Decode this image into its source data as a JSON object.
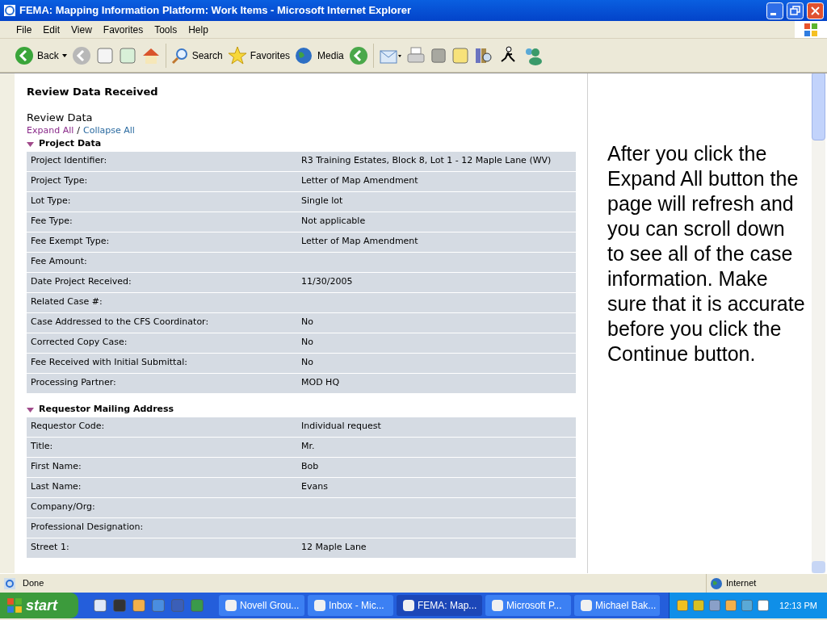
{
  "window": {
    "title": "FEMA: Mapping Information Platform: Work Items - Microsoft Internet Explorer"
  },
  "menu": [
    "File",
    "Edit",
    "View",
    "Favorites",
    "Tools",
    "Help"
  ],
  "toolbar": [
    {
      "label": "Back"
    },
    {
      "label": "Search"
    },
    {
      "label": "Favorites"
    },
    {
      "label": "Media"
    }
  ],
  "page": {
    "heading": "Review Data Received",
    "subheading": "Review Data",
    "expand_link": "Expand All",
    "separator": "/",
    "collapse_link": "Collapse All",
    "sections": [
      {
        "title": "Project Data",
        "expanded": true,
        "rows": [
          {
            "label": "Project Identifier:",
            "value": "R3 Training Estates, Block 8, Lot 1 - 12 Maple Lane (WV)"
          },
          {
            "label": "Project Type:",
            "value": "Letter of Map Amendment"
          },
          {
            "label": "Lot Type:",
            "value": "Single lot"
          },
          {
            "label": "Fee Type:",
            "value": "Not applicable"
          },
          {
            "label": "Fee Exempt Type:",
            "value": "Letter of Map Amendment"
          },
          {
            "label": "Fee Amount:"
          },
          {
            "label": "Date Project Received:",
            "value": "11/30/2005"
          },
          {
            "label": "Related Case #:"
          },
          {
            "label": "Case Addressed to the CFS Coordinator:",
            "value": "No"
          },
          {
            "label": "Corrected Copy Case:",
            "value": "No"
          },
          {
            "label": "Fee Received with Initial Submittal:",
            "value": "No"
          },
          {
            "label": "Processing Partner:",
            "value": "MOD HQ"
          }
        ]
      },
      {
        "title": "Requestor Mailing Address",
        "expanded": true,
        "rows": [
          {
            "label": "Requestor Code:",
            "value": "Individual request"
          },
          {
            "label": "Title:",
            "value": "Mr."
          },
          {
            "label": "First Name:",
            "value": "Bob"
          },
          {
            "label": "Last Name:",
            "value": "Evans"
          },
          {
            "label": "Company/Org:"
          },
          {
            "label": "Professional Designation:"
          },
          {
            "label": "Street 1:",
            "value": "12 Maple Lane"
          }
        ]
      }
    ]
  },
  "callout": "After you click the Expand All button the page will refresh and you can scroll down to see all of the case information. Make sure that it is accurate before you click the Continue button.",
  "status_bar": {
    "text": "Done",
    "zone": "Internet"
  },
  "taskbar": {
    "start": "start",
    "tasks": [
      {
        "label": "Novell Grou...",
        "selected": false
      },
      {
        "label": "Inbox - Mic...",
        "selected": false
      },
      {
        "label": "FEMA: Map...",
        "selected": true
      },
      {
        "label": "Microsoft P...",
        "selected": false
      },
      {
        "label": "Michael Bak...",
        "selected": false
      }
    ],
    "clock": "12:13 PM"
  }
}
